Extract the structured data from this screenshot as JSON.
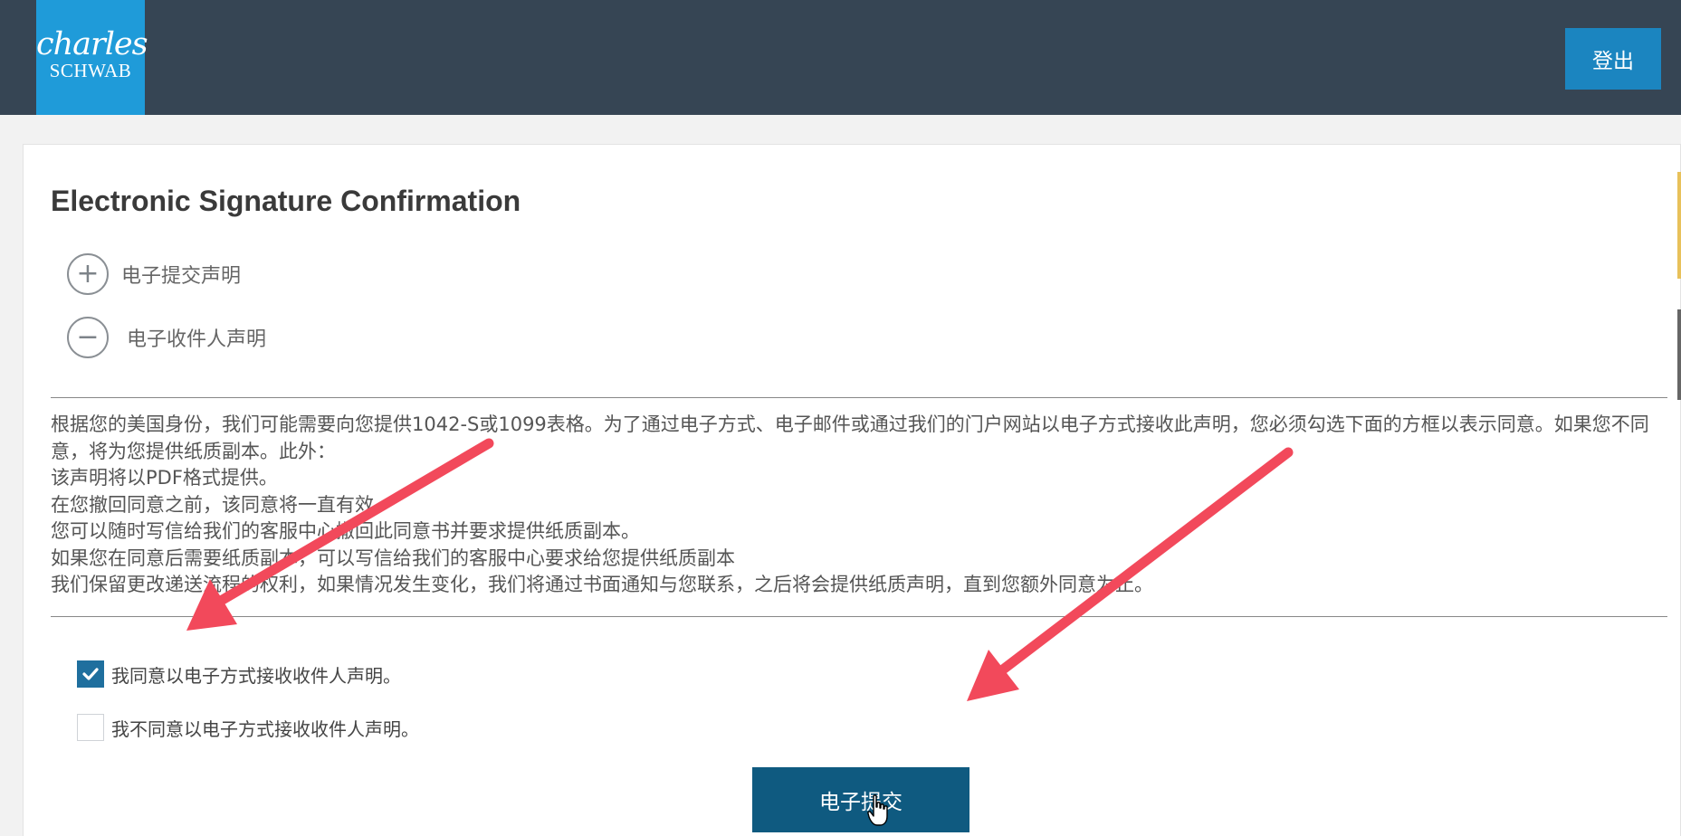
{
  "header": {
    "logo_line1": "charles",
    "logo_line2": "SCHWAB",
    "logout_label": "登出"
  },
  "main": {
    "title": "Electronic Signature Confirmation",
    "accordion": [
      {
        "icon": "+",
        "label": "电子提交声明",
        "state": "collapsed"
      },
      {
        "icon": "−",
        "label": "电子收件人声明",
        "state": "expanded"
      }
    ],
    "statement_lines": [
      "根据您的美国身份，我们可能需要向您提供1042-S或1099表格。为了通过电子方式、电子邮件或通过我们的门户网站以电子方式接收此声明，您必须勾选下面的方框以表示同意。如果您不同意，将为您提供纸质副本。此外：",
      "该声明将以PDF格式提供。",
      "在您撤回同意之前，该同意将一直有效。",
      "您可以随时写信给我们的客服中心撤回此同意书并要求提供纸质副本。",
      "如果您在同意后需要纸质副本，可以写信给我们的客服中心要求给您提供纸质副本",
      "我们保留更改递送流程的权利，如果情况发生变化，我们将通过书面通知与您联系，之后将会提供纸质声明，直到您额外同意为止。"
    ],
    "consent_options": [
      {
        "label": "我同意以电子方式接收收件人声明。",
        "checked": true
      },
      {
        "label": "我不同意以电子方式接收收件人声明。",
        "checked": false
      }
    ],
    "submit_label": "电子提交"
  },
  "colors": {
    "header_bg": "#364554",
    "logo_bg": "#1f9bd9",
    "accent_button": "#1b85c0",
    "submit_button": "#0f5a80",
    "checkbox_checked": "#1f6f9e",
    "annotation_arrow": "#f2495b"
  }
}
